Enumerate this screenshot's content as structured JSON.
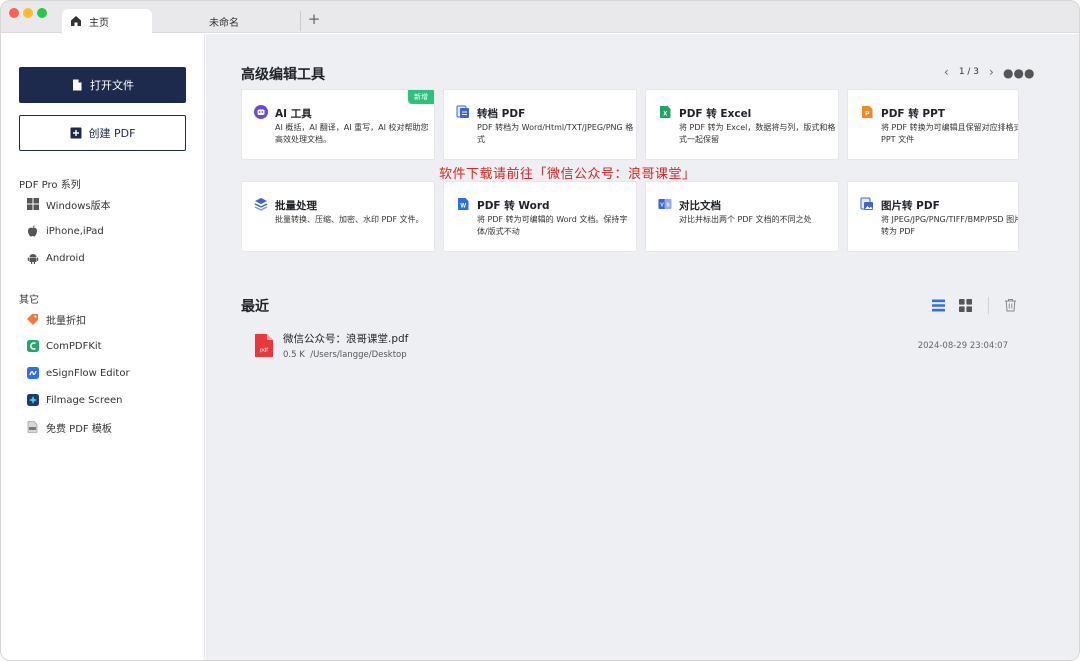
{
  "tabs": {
    "home_label": "主页",
    "untitled_label": "未命名",
    "add_symbol": "+"
  },
  "sidebar": {
    "open_label": "打开文件",
    "create_label": "创建 PDF",
    "section_pro": "PDF Pro 系列",
    "pro_items": [
      {
        "label": "Windows版本",
        "icon": "windows-icon"
      },
      {
        "label": "iPhone,iPad",
        "icon": "apple-icon"
      },
      {
        "label": "Android",
        "icon": "android-icon"
      }
    ],
    "section_other": "其它",
    "other_items": [
      {
        "label": "批量折扣",
        "icon": "tag-icon"
      },
      {
        "label": "ComPDFKit",
        "icon": "compdfkit-icon"
      },
      {
        "label": "eSignFlow Editor",
        "icon": "esignflow-icon"
      },
      {
        "label": "Filmage Screen",
        "icon": "filmage-icon"
      },
      {
        "label": "免费 PDF 模板",
        "icon": "pdf-template-icon"
      }
    ]
  },
  "tools": {
    "title": "高级编辑工具",
    "pager": "1 / 3",
    "cards": [
      {
        "title": "AI 工具",
        "desc": "AI 概括，AI 翻译，AI 重写，AI 校对帮助您高效处理文档。",
        "badge": "新增",
        "icon": "ai-icon"
      },
      {
        "title": "转档 PDF",
        "desc": "PDF 转档为 Word/Html/TXT/JPEG/PNG 格式",
        "icon": "convert-icon"
      },
      {
        "title": "PDF 转 Excel",
        "desc": "将 PDF 转为 Excel，数据将与列，版式和格式一起保留",
        "icon": "excel-icon"
      },
      {
        "title": "PDF 转 PPT",
        "desc": "将 PDF 转换为可编辑且保留对应排格式的 PPT 文件",
        "icon": "ppt-icon"
      },
      {
        "title": "批量处理",
        "desc": "批量转换、压缩、加密、水印 PDF 文件。",
        "icon": "layers-icon"
      },
      {
        "title": "PDF 转 Word",
        "desc": "将 PDF 转为可编辑的 Word 文档。保持字体/版式不动",
        "icon": "word-icon"
      },
      {
        "title": "对比文档",
        "desc": "对比并标出两个 PDF 文档的不同之处",
        "icon": "compare-icon"
      },
      {
        "title": "图片转 PDF",
        "desc": "将 JPEG/JPG/PNG/TIFF/BMP/PSD 图片格式转为 PDF",
        "icon": "image-pdf-icon"
      }
    ]
  },
  "watermark": "软件下载请前往「微信公众号：浪哥课堂」",
  "recent": {
    "title": "最近",
    "files": [
      {
        "name": "微信公众号：浪哥课堂.pdf",
        "size": "0.5 K",
        "path": "/Users/langge/Desktop",
        "date": "2024-08-29 23:04:07"
      }
    ]
  },
  "colors": {
    "primary": "#1d2a4d",
    "badge": "#2ec17c",
    "watermark": "#e02020",
    "pdf_red": "#e8383d",
    "accent_blue": "#3a63d6"
  }
}
